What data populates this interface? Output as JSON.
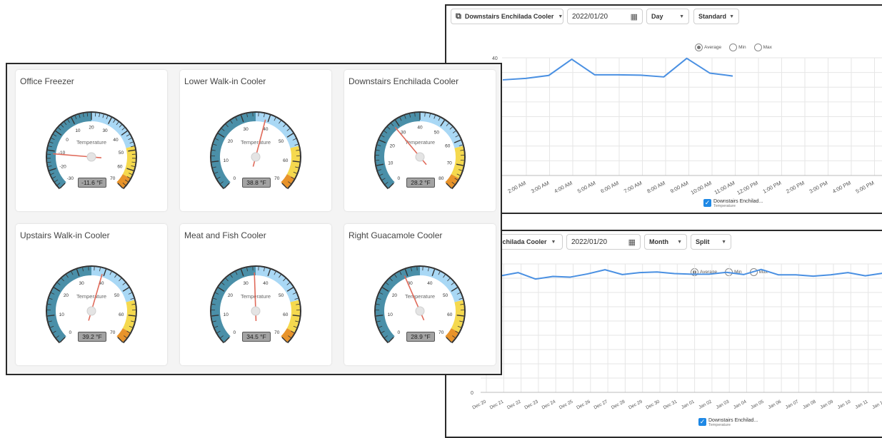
{
  "top_panel": {
    "device_label": "Downstairs Enchilada Cooler",
    "date": "2022/01/20",
    "period": "Day",
    "mode": "Standard",
    "radios": [
      "Average",
      "Min",
      "Max"
    ],
    "selected_radio": "Average",
    "legend": {
      "label": "Downstairs Enchilad...",
      "sublabel": "Temperature",
      "checked": true
    },
    "colors": {
      "line": "#4a90e2",
      "grid": "#e6e6e6"
    }
  },
  "bottom_panel": {
    "device_label": "nchilada Cooler",
    "date": "2022/01/20",
    "period": "Month",
    "mode": "Split",
    "radios": [
      "Average",
      "Min",
      "Max"
    ],
    "selected_radio": "Average",
    "legend": {
      "label": "Downstairs Enchilad...",
      "sublabel": "Temperature",
      "checked": true
    }
  },
  "chart_data": [
    {
      "type": "line",
      "title": "",
      "ylabel": "",
      "y_tick_labels": [
        "40"
      ],
      "ylim": [
        0,
        40
      ],
      "x": [
        "1:00 AM",
        "2:00 AM",
        "3:00 AM",
        "4:00 AM",
        "5:00 AM",
        "6:00 AM",
        "7:00 AM",
        "8:00 AM",
        "9:00 AM",
        "10:00 AM",
        "11:00 AM"
      ],
      "x_tick_labels": [
        "2:00 AM",
        "3:00 AM",
        "4:00 AM",
        "5:00 AM",
        "6:00 AM",
        "7:00 AM",
        "8:00 AM",
        "9:00 AM",
        "10:00 AM",
        "11:00 AM",
        "12:00 PM",
        "1:00 PM",
        "2:00 PM",
        "3:00 PM",
        "4:00 PM",
        "5:00 PM",
        "6:0"
      ],
      "series": [
        {
          "name": "Downstairs Enchilad...",
          "values": [
            32.5,
            33,
            34,
            39.5,
            34.2,
            34.2,
            34.1,
            33.5,
            39.8,
            34.8,
            33.8
          ]
        }
      ],
      "grid": true,
      "legend": "bottom"
    },
    {
      "type": "line",
      "title": "",
      "ylabel": "",
      "y_tick_labels": [
        "0"
      ],
      "ylim": [
        0,
        40
      ],
      "x": [
        "Dec 20",
        "Dec 21",
        "Dec 22",
        "Dec 23",
        "Dec 24",
        "Dec 25",
        "Dec 26",
        "Dec 27",
        "Dec 28",
        "Dec 29",
        "Dec 30",
        "Dec 31",
        "Jan 01",
        "Jan 02",
        "Jan 03",
        "Jan 04",
        "Jan 05",
        "Jan 06",
        "Jan 07",
        "Jan 08",
        "Jan 09",
        "Jan 10",
        "Jan 11",
        "Jan 12",
        "Jan 13"
      ],
      "x_tick_labels": [
        "Dec 20",
        "Dec 21",
        "Dec 22",
        "Dec 23",
        "Dec 24",
        "Dec 25",
        "Dec 26",
        "Dec 27",
        "Dec 28",
        "Dec 29",
        "Dec 30",
        "Dec 31",
        "Jan 01",
        "Jan 02",
        "Jan 03",
        "Jan 04",
        "Jan 05",
        "Jan 06",
        "Jan 07",
        "Jan 08",
        "Jan 09",
        "Jan 10",
        "Jan 11",
        "Jan 12",
        "J"
      ],
      "series": [
        {
          "name": "Downstairs Enchilad...",
          "values": [
            37.5,
            36.3,
            37.3,
            35.3,
            36.1,
            35.9,
            36.9,
            38.2,
            36.7,
            37.3,
            37.5,
            37.0,
            36.8,
            36.8,
            37.4,
            36.7,
            38.3,
            36.6,
            36.6,
            36.2,
            36.6,
            37.3,
            36.3,
            37.1,
            36.8
          ]
        }
      ],
      "grid": true,
      "legend": "bottom"
    }
  ],
  "gauges": [
    {
      "title": "Office Freezer",
      "value": -11.6,
      "readout": "-11.6 °F",
      "min": -30,
      "max": 70,
      "ticks": [
        "-30",
        "-20",
        "-10",
        "0",
        "10",
        "20",
        "30",
        "40",
        "50",
        "60",
        "70"
      ],
      "label": "Temperature"
    },
    {
      "title": "Lower Walk-in Cooler",
      "value": 38.8,
      "readout": "38.8 °F",
      "min": 0,
      "max": 70,
      "ticks": [
        "0",
        "10",
        "20",
        "30",
        "40",
        "50",
        "60",
        "70"
      ],
      "label": "Temperature"
    },
    {
      "title": "Downstairs Enchilada Cooler",
      "value": 28.2,
      "readout": "28.2 °F",
      "min": 0,
      "max": 80,
      "ticks": [
        "0",
        "10",
        "20",
        "30",
        "40",
        "50",
        "60",
        "70",
        "80"
      ],
      "label": "Temperature"
    },
    {
      "title": "Upstairs Walk-in Cooler",
      "value": 39.2,
      "readout": "39.2 °F",
      "min": 0,
      "max": 70,
      "ticks": [
        "0",
        "10",
        "20",
        "30",
        "40",
        "50",
        "60",
        "70"
      ],
      "label": "Temperature"
    },
    {
      "title": "Meat and Fish Cooler",
      "value": 34.5,
      "readout": "34.5 °F",
      "min": 0,
      "max": 70,
      "ticks": [
        "0",
        "10",
        "20",
        "30",
        "40",
        "50",
        "60",
        "70"
      ],
      "label": "Temperature"
    },
    {
      "title": "Right Guacamole Cooler",
      "value": 28.9,
      "readout": "28.9 °F",
      "min": 0,
      "max": 70,
      "ticks": [
        "0",
        "10",
        "20",
        "30",
        "40",
        "50",
        "60",
        "70"
      ],
      "label": "Temperature"
    }
  ],
  "gauge_colors": {
    "cold": "#4a8fa8",
    "normal": "#a9d8f5",
    "warm": "#f5d94e",
    "hot": "#e8932a",
    "needle": "#e06a5a",
    "frame": "#333333"
  }
}
